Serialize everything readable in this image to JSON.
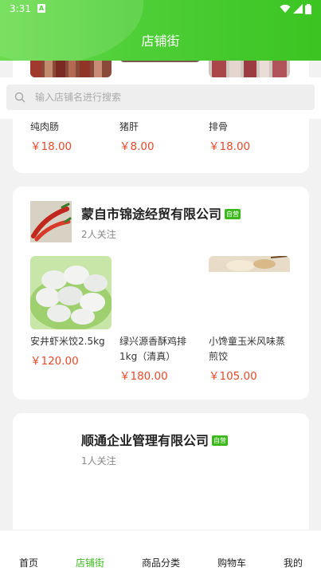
{
  "status": {
    "time": "3:31",
    "a_icon": "A"
  },
  "header": {
    "title": "店铺街"
  },
  "search": {
    "placeholder": "输入店铺名进行搜索"
  },
  "top_card": {
    "products": [
      {
        "name": "纯肉肠",
        "price": "￥18.00"
      },
      {
        "name": "猪肝",
        "price": "￥8.00"
      },
      {
        "name": "排骨",
        "price": "￥18.00"
      }
    ]
  },
  "shops": [
    {
      "name": "蒙自市锦途经贸有限公司",
      "badge": "自营",
      "followers": "2人关注",
      "products": [
        {
          "name": "安井虾米饺2.5kg",
          "price": "￥120.00"
        },
        {
          "name": "绿兴源香酥鸡排1kg（清真）",
          "price": "￥180.00"
        },
        {
          "name": "小馋童玉米风味蒸煎饺",
          "price": "￥105.00"
        }
      ]
    },
    {
      "name": "顺通企业管理有限公司",
      "badge": "自营",
      "followers": "1人关注",
      "products": []
    }
  ],
  "nav": {
    "items": [
      {
        "label": "首页",
        "active": false
      },
      {
        "label": "店铺街",
        "active": true
      },
      {
        "label": "商品分类",
        "active": false
      },
      {
        "label": "购物车",
        "active": false
      },
      {
        "label": "我的",
        "active": false
      }
    ]
  },
  "colors": {
    "accent": "#3bb81c",
    "price": "#e84a2b",
    "header": "#4fcf38"
  }
}
